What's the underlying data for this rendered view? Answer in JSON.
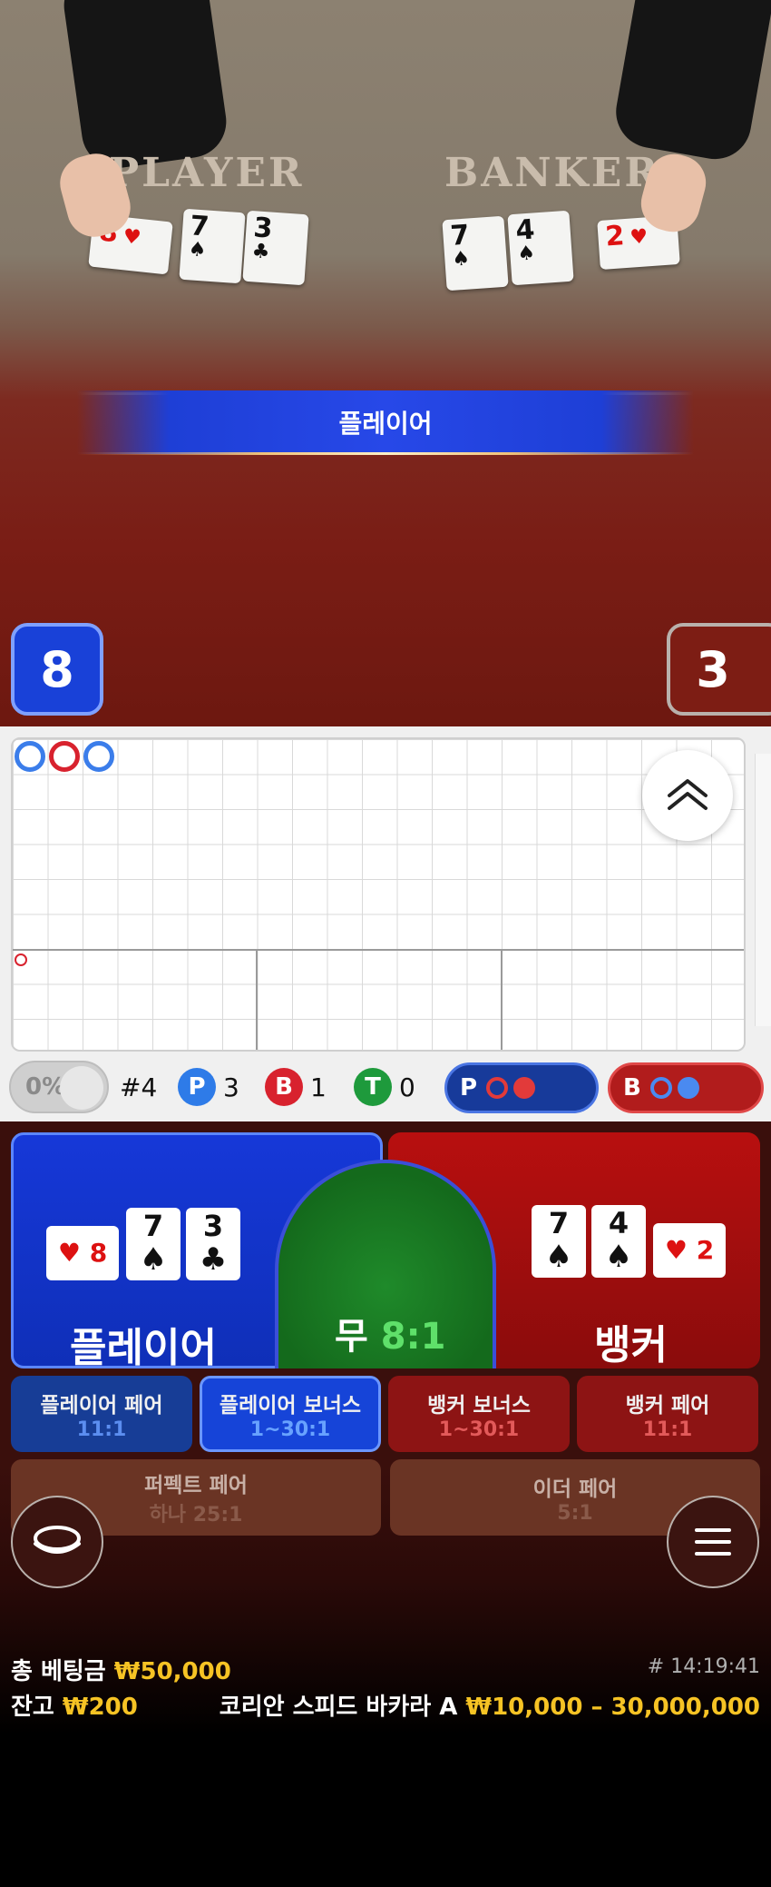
{
  "table": {
    "felt_player": "PLAYER",
    "felt_banker": "BANKER",
    "result_banner": "플레이어",
    "player_score": "8",
    "banker_score": "3",
    "player_cards": [
      {
        "rank": "8",
        "suit": "♥",
        "color": "red"
      },
      {
        "rank": "7",
        "suit": "♠",
        "color": "black"
      },
      {
        "rank": "3",
        "suit": "♣",
        "color": "black"
      }
    ],
    "banker_cards": [
      {
        "rank": "7",
        "suit": "♠",
        "color": "black"
      },
      {
        "rank": "4",
        "suit": "♠",
        "color": "black"
      },
      {
        "rank": "2",
        "suit": "♥",
        "color": "red"
      }
    ]
  },
  "stats": {
    "percent": "0%",
    "round": "#4",
    "player_letter": "P",
    "player_count": "3",
    "banker_letter": "B",
    "banker_count": "1",
    "tie_letter": "T",
    "tie_count": "0",
    "predict_player": "P",
    "predict_banker": "B"
  },
  "bets": {
    "player_label": "플레이어",
    "banker_label": "뱅커",
    "tie_label": "무",
    "tie_odds": "8:1",
    "player_pair": {
      "title": "플레이어 페어",
      "odds": "11:1"
    },
    "player_bonus": {
      "title": "플레이어 보너스",
      "odds": "1~30:1"
    },
    "banker_bonus": {
      "title": "뱅커 보너스",
      "odds": "1~30:1"
    },
    "banker_pair": {
      "title": "뱅커 페어",
      "odds": "11:1"
    },
    "perfect_pair": {
      "title": "퍼펙트 페어",
      "odds": "하나 25:1"
    },
    "either_pair": {
      "title": "이더 페어",
      "odds": "5:1"
    }
  },
  "footer": {
    "total_bet_label": "총 베팅금",
    "total_bet_value": "₩50,000",
    "balance_label": "잔고",
    "balance_value": "₩200",
    "timestamp": "# 14:19:41",
    "table_name": "코리안 스피드 바카라 A",
    "limits": "₩10,000 – 30,000,000"
  },
  "colors": {
    "player_blue": "#1638d8",
    "banker_red": "#b80f0f",
    "tie_green": "#1f8a2a",
    "accent_yellow": "#f6c324"
  },
  "icons": [
    "chevron-double-up-icon",
    "chip-stack-icon",
    "menu-icon"
  ]
}
